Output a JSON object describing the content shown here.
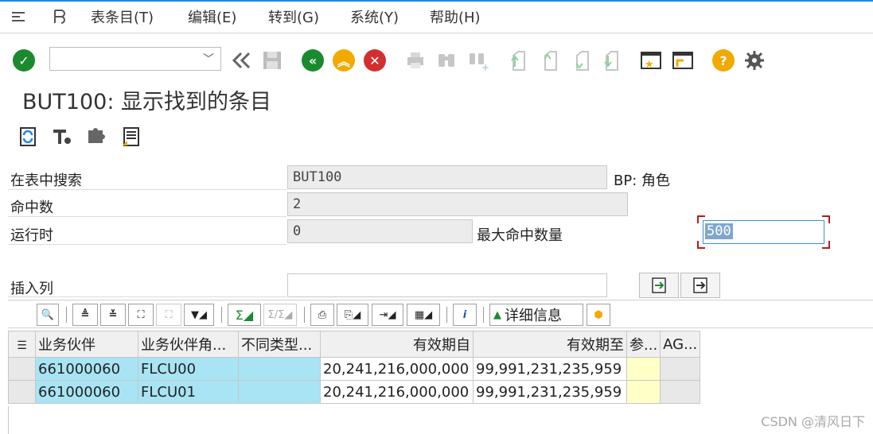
{
  "menubar": {
    "items": [
      "表条目(T)",
      "编辑(E)",
      "转到(G)",
      "系统(Y)",
      "帮助(H)"
    ]
  },
  "toolbar": {
    "command_value": ""
  },
  "page": {
    "title": "BUT100: 显示找到的条目"
  },
  "form": {
    "search_table_label": "在表中搜索",
    "search_table_value": "BUT100",
    "search_table_desc": "BP: 角色",
    "hits_label": "命中数",
    "hits_value": "2",
    "runtime_label": "运行时",
    "runtime_value": "0",
    "max_hits_label": "最大命中数量",
    "max_hits_value": "500",
    "insert_col_label": "插入列",
    "insert_col_value": ""
  },
  "alv": {
    "details_label": "详细信息"
  },
  "grid": {
    "headers": [
      "业务伙伴",
      "业务伙伴角...",
      "不同类型...",
      "有效期自",
      "有效期至",
      "参...",
      "AG..."
    ],
    "rows": [
      [
        "661000060",
        "FLCU00",
        "",
        "20,241,216,000,000",
        "99,991,231,235,959",
        "",
        ""
      ],
      [
        "661000060",
        "FLCU01",
        "",
        "20,241,216,000,000",
        "99,991,231,235,959",
        "",
        ""
      ]
    ]
  },
  "watermark": "CSDN @清风日下",
  "colors": {
    "accent": "#1e88e5",
    "ok_green": "#1a8a2e",
    "warn_orange": "#f2a900",
    "cancel_red": "#d32f2f",
    "selection_blue": "#a8e4f4"
  }
}
